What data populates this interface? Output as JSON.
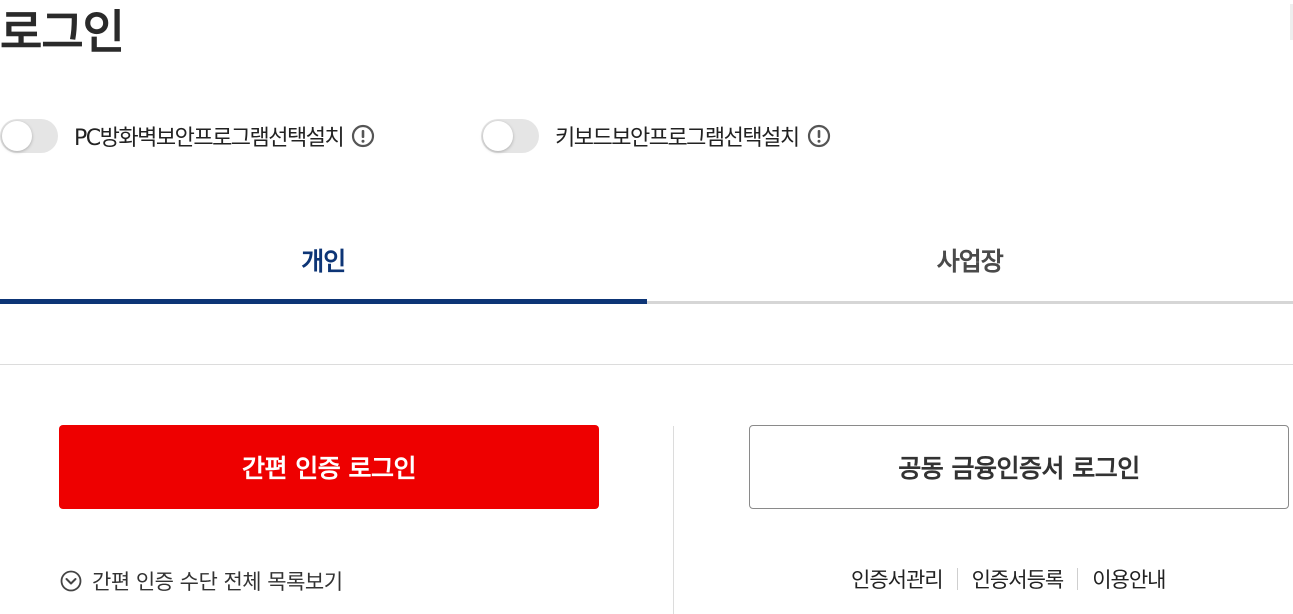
{
  "page": {
    "title": "로그인"
  },
  "toggles": [
    {
      "label": "PC방화벽보안프로그램선택설치",
      "on": false
    },
    {
      "label": "키보드보안프로그램선택설치",
      "on": false
    }
  ],
  "tabs": [
    {
      "label": "개인",
      "active": true
    },
    {
      "label": "사업장",
      "active": false
    }
  ],
  "simple_login": {
    "button_label": "간편 인증 로그인",
    "list_link_label": "간편 인증 수단 전체 목록보기"
  },
  "cert_login": {
    "button_label": "공동 금융인증서 로그인",
    "links": [
      "인증서관리",
      "인증서등록",
      "이용안내"
    ]
  },
  "colors": {
    "accent": "#0d3576",
    "primary_button": "#ee0000",
    "toggle_off": "#e5e5e5"
  },
  "icons": {
    "info": "info-circle-icon",
    "chevron": "chevron-down-circle-icon"
  }
}
